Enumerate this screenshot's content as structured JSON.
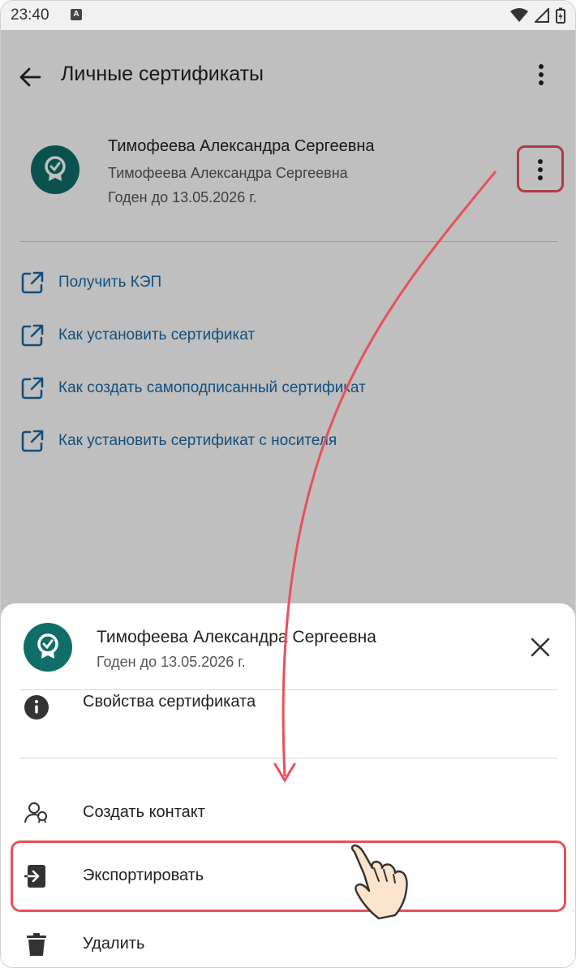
{
  "status_bar": {
    "time": "23:40",
    "notification_icon": "A",
    "icons": [
      "wifi-icon",
      "signal-icon",
      "battery-icon"
    ]
  },
  "toolbar": {
    "title": "Личные сертификаты",
    "back_icon": "arrow-back-icon",
    "more_icon": "more-vertical-icon"
  },
  "certificate": {
    "name": "Тимофеева Александра Сергеевна",
    "subject": "Тимофеева Александра Сергеевна",
    "valid_until": "Годен до 13.05.2026 г.",
    "icon": "certificate-badge-icon"
  },
  "links": [
    {
      "label": "Получить КЭП",
      "icon": "external-link-icon"
    },
    {
      "label": "Как установить сертификат",
      "icon": "external-link-icon"
    },
    {
      "label": "Как создать самоподписанный сертификат",
      "icon": "external-link-icon"
    },
    {
      "label": "Как установить сертификат с носителя",
      "icon": "external-link-icon"
    }
  ],
  "sheet": {
    "name": "Тимофеева Александра Сергеевна",
    "valid_until": "Годен до 13.05.2026 г.",
    "items": [
      {
        "label": "Свойства сертификата",
        "icon": "info-icon"
      },
      {
        "label": "Создать контакт",
        "icon": "add-contact-icon"
      },
      {
        "label": "Экспортировать",
        "icon": "export-icon"
      },
      {
        "label": "Удалить",
        "icon": "trash-icon"
      }
    ]
  },
  "colors": {
    "accent_teal": "#0f6e68",
    "link_blue": "#1a6aa8",
    "highlight_red": "#e8505b"
  }
}
